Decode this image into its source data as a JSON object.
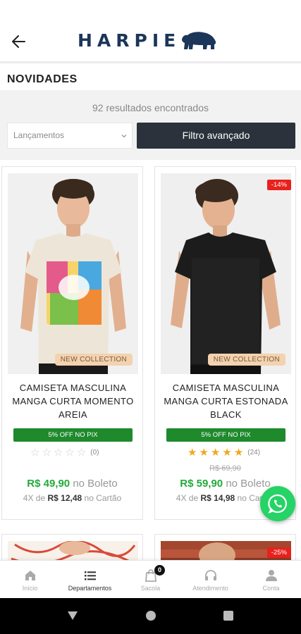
{
  "header": {
    "brand": "HARPIE",
    "back_icon": "arrow-left-icon",
    "logo_icon": "bear-icon",
    "brand_color": "#1c3659"
  },
  "page": {
    "title": "NOVIDADES"
  },
  "filters": {
    "result_count": "92 resultados encontrados",
    "sort_value": "Lançamentos",
    "advanced_filter_label": "Filtro avançado"
  },
  "products": [
    {
      "name": "CAMISETA MASCULINA MANGA CURTA MOMENTO AREIA",
      "badge": "NEW COLLECTION",
      "discount": "",
      "pix_tag": "5% OFF NO PIX",
      "rating": 0,
      "rating_count": "(0)",
      "old_price": "",
      "price": "R$ 49,90",
      "price_suffix": "no Boleto",
      "installments_prefix": "4X de",
      "installment_value": "R$ 12,48",
      "installments_suffix": "no Cartão",
      "shirt_color": "#ede6d8"
    },
    {
      "name": "CAMISETA MASCULINA MANGA CURTA ESTONADA BLACK",
      "badge": "NEW COLLECTION",
      "discount": "-14%",
      "pix_tag": "5% OFF NO PIX",
      "rating": 5,
      "rating_count": "(24)",
      "old_price": "R$ 69,90",
      "price": "R$ 59,90",
      "price_suffix": "no Boleto",
      "installments_prefix": "4X de",
      "installment_value": "R$ 14,98",
      "installments_suffix": "no Cartão",
      "shirt_color": "#1c1c1c"
    }
  ],
  "next_row": {
    "right_discount": "-25%"
  },
  "bottom_nav": [
    {
      "label": "Início",
      "icon": "home-icon"
    },
    {
      "label": "Departamentos",
      "icon": "list-icon"
    },
    {
      "label": "Sacola",
      "icon": "bag-icon",
      "count": "0"
    },
    {
      "label": "Atendimento",
      "icon": "headset-icon"
    },
    {
      "label": "Conta",
      "icon": "user-icon"
    }
  ],
  "colors": {
    "price_green": "#22aa3a",
    "pix_green": "#1e8a2c",
    "discount_red": "#e8211c",
    "whatsapp": "#25d366"
  }
}
